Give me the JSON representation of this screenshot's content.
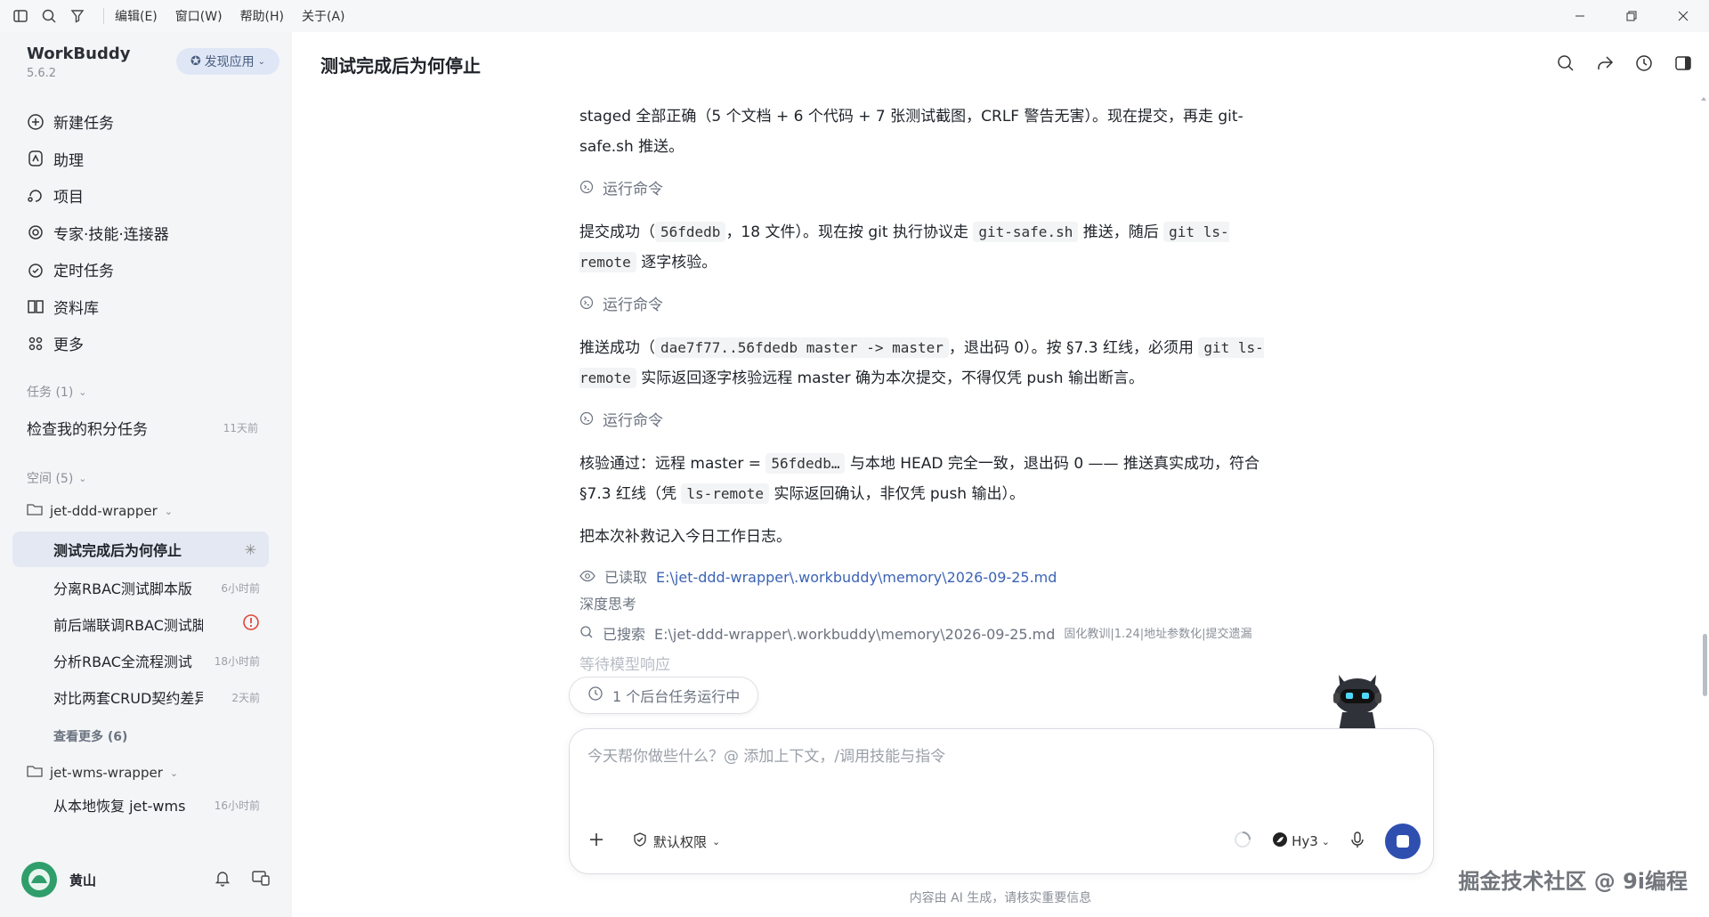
{
  "menubar": {
    "items": [
      "编辑(E)",
      "窗口(W)",
      "帮助(H)",
      "关于(A)"
    ]
  },
  "brand": {
    "name": "WorkBuddy",
    "version": "5.6.2",
    "discover_label": "发现应用"
  },
  "nav": [
    {
      "label": "新建任务",
      "icon": "plus-circle-icon"
    },
    {
      "label": "助理",
      "icon": "assistant-icon"
    },
    {
      "label": "项目",
      "icon": "project-icon"
    },
    {
      "label": "专家·技能·连接器",
      "icon": "expert-icon"
    },
    {
      "label": "定时任务",
      "icon": "alarm-icon"
    },
    {
      "label": "资料库",
      "icon": "book-icon"
    },
    {
      "label": "更多",
      "icon": "grid-icon"
    }
  ],
  "tasks_section": {
    "label": "任务 (1)",
    "items": [
      {
        "label": "检查我的积分任务",
        "time": "11天前"
      }
    ]
  },
  "spaces_section": {
    "label": "空间 (5)",
    "workspace1": {
      "name": "jet-ddd-wrapper",
      "items": [
        {
          "label": "测试完成后为何停止",
          "time": ""
        },
        {
          "label": "分离RBAC测试脚本版",
          "time": "6小时前"
        },
        {
          "label": "前后端联调RBAC测试脚本",
          "time": ""
        },
        {
          "label": "分析RBAC全流程测试",
          "time": "18小时前"
        },
        {
          "label": "对比两套CRUD契约差异",
          "time": "2天前"
        }
      ],
      "more": "查看更多 (6)"
    },
    "workspace2": {
      "name": "jet-wms-wrapper",
      "items": [
        {
          "label": "从本地恢复 jet-wms",
          "time": "16小时前"
        }
      ]
    }
  },
  "user": {
    "name": "黄山"
  },
  "page": {
    "title": "测试完成后为何停止"
  },
  "chat": {
    "msg1": "staged 全部正确（5 个文档 + 6 个代码 + 7 张测试截图，CRLF 警告无害）。现在提交，再走 git-safe.sh 推送。",
    "run_cmd": "运行命令",
    "msg2_a": "提交成功（",
    "msg2_code1": "56fdedb",
    "msg2_b": "，18 文件）。现在按 git 执行协议走",
    "msg2_code2": "git-safe.sh",
    "msg2_c": "推送，随后",
    "msg2_code3": "git ls-remote",
    "msg2_d": "逐字核验。",
    "msg3_a": "推送成功（",
    "msg3_code1": "dae7f77..56fdedb master -> master",
    "msg3_b": "，退出码 0）。按 §7.3 红线，必须用",
    "msg3_code2": "git ls-remote",
    "msg3_c": "实际返回逐字核验远程 master 确为本次提交，不得仅凭 push 输出断言。",
    "msg4_a": "核验通过：远程 master =",
    "msg4_code1": "56fdedb…",
    "msg4_b": "与本地 HEAD 完全一致，退出码 0 —— 推送真实成功，符合 §7.3 红线（凭",
    "msg4_code2": "ls-remote",
    "msg4_c": "实际返回确认，非仅凭 push 输出）。",
    "msg5": "把本次补救记入今日工作日志。",
    "read_label": "已读取",
    "read_path": "E:\\jet-ddd-wrapper\\.workbuddy\\memory\\2026-09-25.md",
    "thinking": "深度思考",
    "search_label": "已搜索",
    "search_path": "E:\\jet-ddd-wrapper\\.workbuddy\\memory\\2026-09-25.md",
    "search_tags": "固化教训|1.24|地址参数化|提交遗漏",
    "waiting": "等待模型响应"
  },
  "bg_task": "1 个后台任务运行中",
  "composer": {
    "placeholder": "今天帮你做些什么？@ 添加上下文，/调用技能与指令",
    "permission": "默认权限",
    "model": "Hy3"
  },
  "footer": "内容由 AI 生成，请核实重要信息",
  "watermark": "掘金技术社区 @ 9i编程",
  "colors": {
    "accent": "#2f4fb0",
    "link": "#3b63b5",
    "sidebar_bg": "#f4f5f7"
  }
}
